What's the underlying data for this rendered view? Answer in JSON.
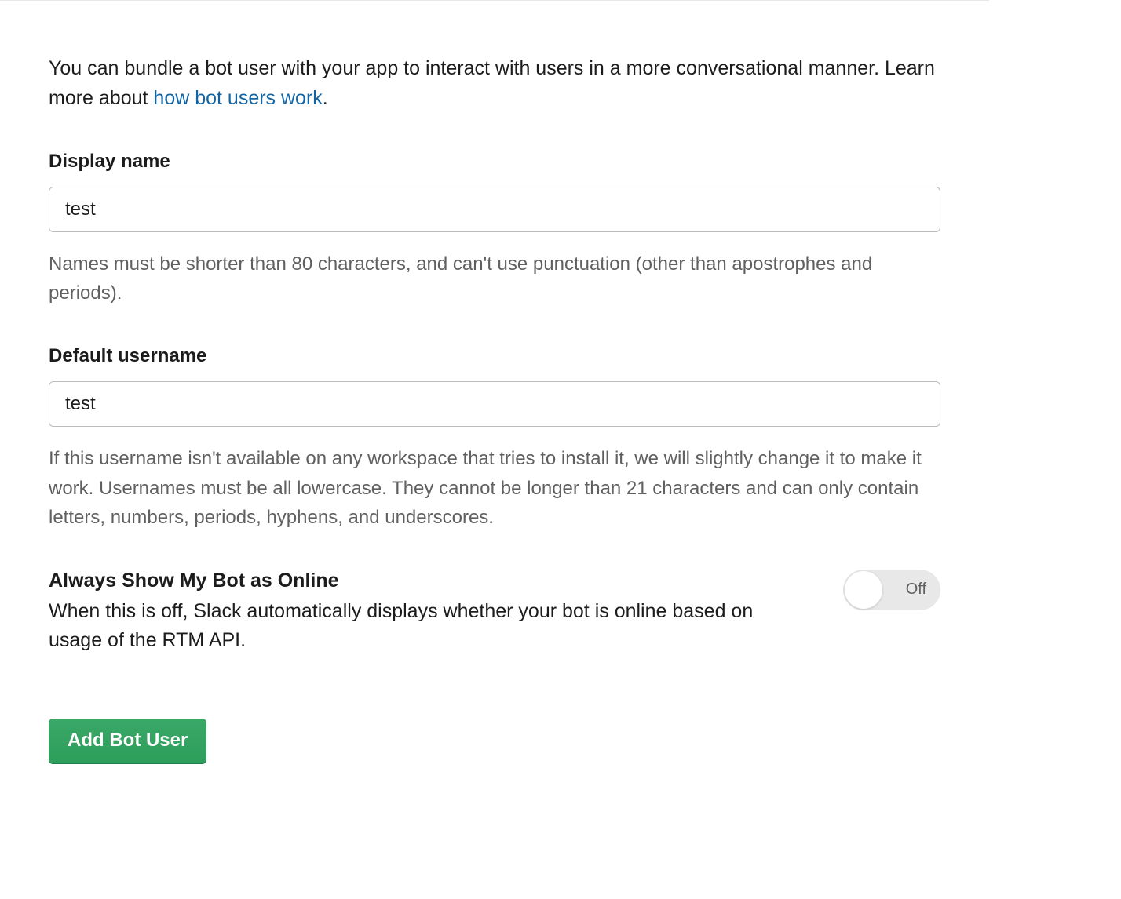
{
  "intro": {
    "text_before_link": "You can bundle a bot user with your app to interact with users in a more conversational manner. Learn more about ",
    "link_text": "how bot users work",
    "text_after_link": "."
  },
  "display_name": {
    "label": "Display name",
    "value": "test",
    "help": "Names must be shorter than 80 characters, and can't use punctuation (other than apostrophes and periods)."
  },
  "default_username": {
    "label": "Default username",
    "value": "test",
    "help": "If this username isn't available on any workspace that tries to install it, we will slightly change it to make it work. Usernames must be all lowercase. They cannot be longer than 21 characters and can only contain letters, numbers, periods, hyphens, and underscores."
  },
  "always_online": {
    "label": "Always Show My Bot as Online",
    "description": "When this is off, Slack automatically displays whether your bot is online based on usage of the RTM API.",
    "state_text": "Off"
  },
  "submit_button": {
    "label": "Add Bot User"
  }
}
